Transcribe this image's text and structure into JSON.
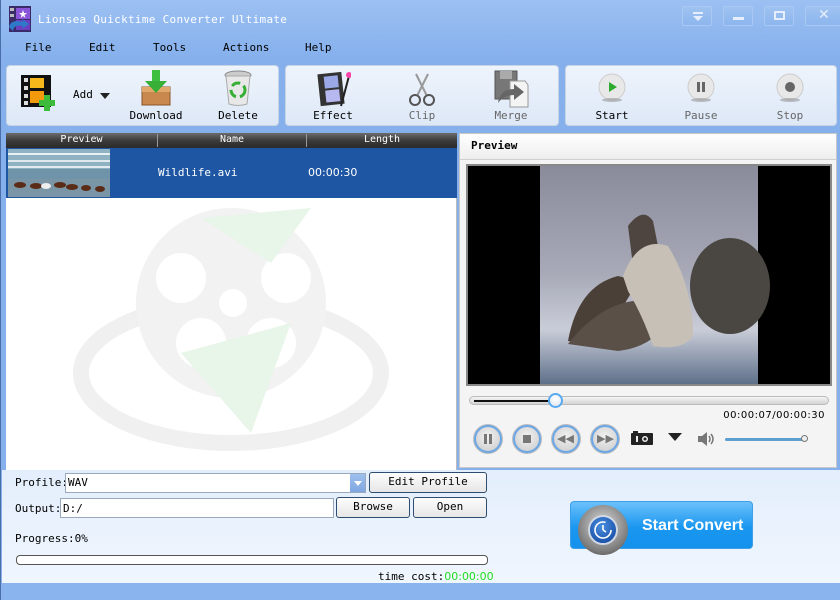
{
  "window": {
    "title": "Lionsea Quicktime Converter Ultimate",
    "controls": [
      "menu-dropdown",
      "minimize",
      "maximize",
      "close"
    ]
  },
  "menu": [
    "File",
    "Edit",
    "Tools",
    "Actions",
    "Help"
  ],
  "toolbar": {
    "add": "Add",
    "download": "Download",
    "delete": "Delete",
    "effect": "Effect",
    "clip": "Clip",
    "merge": "Merge",
    "start": "Start",
    "pause": "Pause",
    "stop": "Stop"
  },
  "file_list": {
    "columns": [
      "Preview",
      "Name",
      "Length"
    ],
    "rows": [
      {
        "name": "Wildlife.avi",
        "length": "00:00:30",
        "selected": true
      }
    ]
  },
  "preview": {
    "title": "Preview",
    "timecode": "00:00:07/00:00:30",
    "position_fraction": 0.233,
    "volume_fraction": 1.0,
    "controls": [
      "pause",
      "stop",
      "rewind",
      "fast-forward",
      "snapshot",
      "snapshot-menu",
      "volume"
    ]
  },
  "settings": {
    "profile_label": "Profile:",
    "profile_value": "WAV",
    "edit_profile": "Edit Profile",
    "output_label": "Output:",
    "output_value": "D:/",
    "browse": "Browse",
    "open": "Open",
    "progress_label": "Progress:",
    "progress_value": "0%",
    "progress_fraction": 0,
    "time_cost_label": "time cost:",
    "time_cost_value": "00:00:00",
    "start_convert": "Start Convert"
  },
  "colors": {
    "accent_blue": "#1f56a3",
    "window_blue": "#8ab4ee",
    "convert_button": "#1a97f0",
    "time_cost_green": "#22dd22"
  }
}
